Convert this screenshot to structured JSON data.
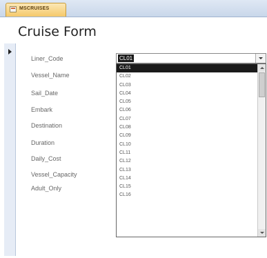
{
  "tab": {
    "label": "MSCRUISES",
    "icon": "form-icon"
  },
  "form": {
    "title": "Cruise Form"
  },
  "fields": [
    {
      "label": "Liner_Code"
    },
    {
      "label": "Vessel_Name"
    },
    {
      "label": "Sail_Date"
    },
    {
      "label": "Embark"
    },
    {
      "label": "Destination"
    },
    {
      "label": "Duration"
    },
    {
      "label": "Daily_Cost"
    },
    {
      "label": "Vessel_Capacity"
    },
    {
      "label": "Adult_Only"
    }
  ],
  "combo": {
    "value": "CL01",
    "button_icon": "chevron-down-icon"
  },
  "dropdown": {
    "options": [
      "CL01",
      "CL02",
      "CL03",
      "CL04",
      "CL05",
      "CL06",
      "CL07",
      "CL08",
      "CL09",
      "CL10",
      "CL11",
      "CL12",
      "CL13",
      "CL14",
      "CL15",
      "CL16"
    ],
    "selected_index": 0
  },
  "colors": {
    "tab_bg": "#f5c96a",
    "selection": "#1a1a1a",
    "selector_bg": "#e6ecf6"
  }
}
